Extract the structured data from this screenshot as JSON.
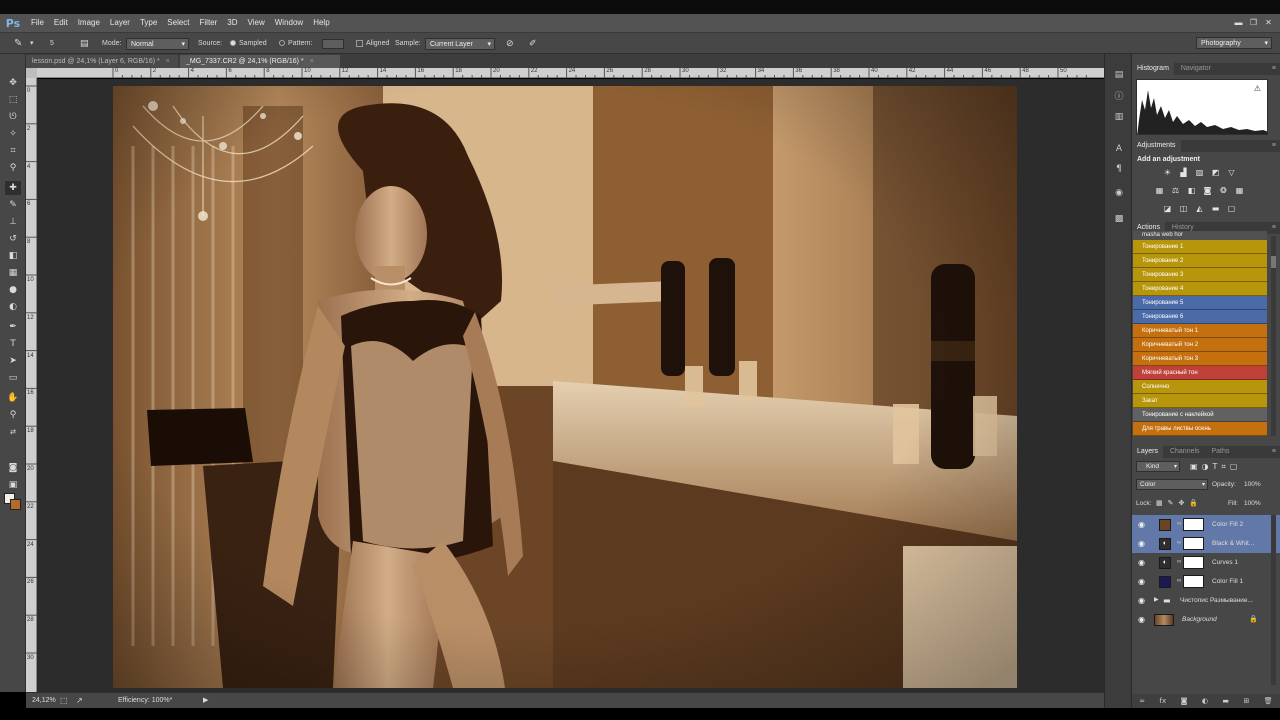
{
  "app": {
    "logo": "Ps"
  },
  "menu": [
    "File",
    "Edit",
    "Image",
    "Layer",
    "Type",
    "Select",
    "Filter",
    "3D",
    "View",
    "Window",
    "Help"
  ],
  "window_controls": {
    "minimize": "▬",
    "restore": "❐",
    "close": "✕"
  },
  "options_bar": {
    "brush_size": "5",
    "mode_label": "Mode:",
    "mode_value": "Normal",
    "source_label": "Source:",
    "sampled": "Sampled",
    "pattern": "Pattern:",
    "aligned": "Aligned",
    "sample_label": "Sample:",
    "sample_value": "Current Layer"
  },
  "workspace": "Photography",
  "doc_tabs": [
    {
      "label": "lesson.psd @ 24,1% (Layer 6, RGB/16) *",
      "active": false
    },
    {
      "label": "_MG_7337.CR2 @ 24,1% (RGB/16) *",
      "active": true
    }
  ],
  "ruler_top_labels": [
    "0",
    "2",
    "4",
    "6",
    "8",
    "10",
    "12",
    "14",
    "16",
    "18",
    "20",
    "22",
    "24",
    "26",
    "28",
    "30",
    "32",
    "34",
    "36",
    "38",
    "40",
    "42",
    "44",
    "46",
    "48",
    "50"
  ],
  "ruler_left_labels": [
    "0",
    "2",
    "4",
    "6",
    "8",
    "10",
    "12",
    "14",
    "16",
    "18",
    "20",
    "22",
    "24",
    "26",
    "28",
    "30",
    "32"
  ],
  "status": {
    "zoom": "24,12%",
    "efficiency": "Efficiency: 100%*"
  },
  "panels": {
    "top_tabs": [
      "Histogram",
      "Navigator"
    ],
    "adjustments_tab": "Adjustments",
    "add_adjustment": "Add an adjustment",
    "actions_tabs": [
      "Actions",
      "History"
    ],
    "actions_top": "masha web hor",
    "actions": [
      {
        "label": "Тонирование 1",
        "color": "#b8960c"
      },
      {
        "label": "Тонирование 2",
        "color": "#b8960c"
      },
      {
        "label": "Тонирование 3",
        "color": "#b8960c"
      },
      {
        "label": "Тонирование 4",
        "color": "#b8960c"
      },
      {
        "label": "Тонирование 5",
        "color": "#4a6aa8"
      },
      {
        "label": "Тонирование 6",
        "color": "#4a6aa8"
      },
      {
        "label": "Коричневатый тон 1",
        "color": "#c4700e"
      },
      {
        "label": "Коричневатый тон 2",
        "color": "#c4700e"
      },
      {
        "label": "Коричневатый тон 3",
        "color": "#c4700e"
      },
      {
        "label": "Мягкий красный тон",
        "color": "#c0403a"
      },
      {
        "label": "Солнечно",
        "color": "#b8960c"
      },
      {
        "label": "Закат",
        "color": "#b8960c"
      },
      {
        "label": "Тонирование с наклейкой",
        "color": "#616161"
      },
      {
        "label": "Для травы листвы осень",
        "color": "#c4700e"
      }
    ],
    "layers_tabs": [
      "Layers",
      "Channels",
      "Paths"
    ],
    "kind_label": "Kind",
    "blend_mode": "Color",
    "opacity_label": "Opacity:",
    "opacity_value": "100%",
    "lock_label": "Lock:",
    "fill_label": "Fill:",
    "fill_value": "100%",
    "layers": [
      {
        "name": "Color Fill 2",
        "selected": true,
        "thumb_color": "#6b4423"
      },
      {
        "name": "Black & Whit...",
        "selected": true,
        "thumb_color": "adjust"
      },
      {
        "name": "Curves 1",
        "selected": false,
        "thumb_color": "adjust"
      },
      {
        "name": "Color Fill 1",
        "selected": false,
        "thumb_color": "#1c1a55"
      },
      {
        "name": "Чистопис Размывание...",
        "selected": false,
        "thumb_color": "group"
      },
      {
        "name": "Background",
        "selected": false,
        "thumb_color": "photo"
      }
    ]
  }
}
